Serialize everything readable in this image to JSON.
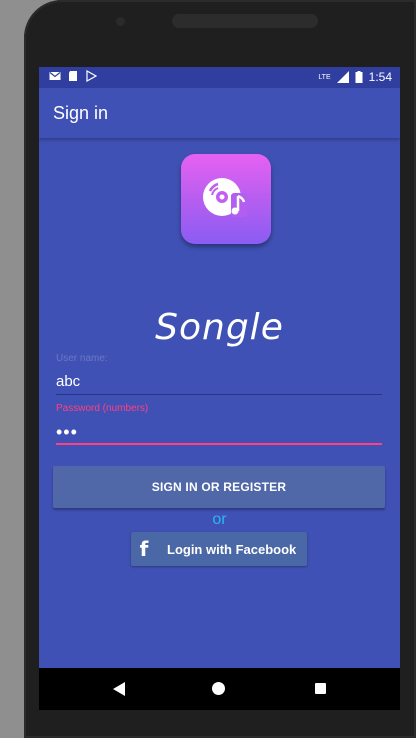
{
  "status_bar": {
    "time": "1:54",
    "network": "LTE",
    "icons": [
      "mail-icon",
      "sd-card-icon",
      "play-store-icon",
      "signal-icon",
      "battery-icon"
    ]
  },
  "app_bar": {
    "title": "Sign in"
  },
  "logo": {
    "icon": "music-disc-icon",
    "colors": [
      "#e661f2",
      "#8b5cf3"
    ]
  },
  "brand": {
    "name": "Songle"
  },
  "form": {
    "username": {
      "label": "User name:",
      "value": "abc"
    },
    "password": {
      "label": "Password (numbers)",
      "value": "•••"
    }
  },
  "actions": {
    "signin_label": "SIGN IN OR REGISTER",
    "or_text": "or",
    "facebook_label": "Login with Facebook",
    "facebook_icon": "facebook-icon"
  },
  "colors": {
    "primary": "#3f51b5",
    "primary_dark": "#303f9f",
    "accent": "#ff4081",
    "or_text": "#29b6f6"
  }
}
